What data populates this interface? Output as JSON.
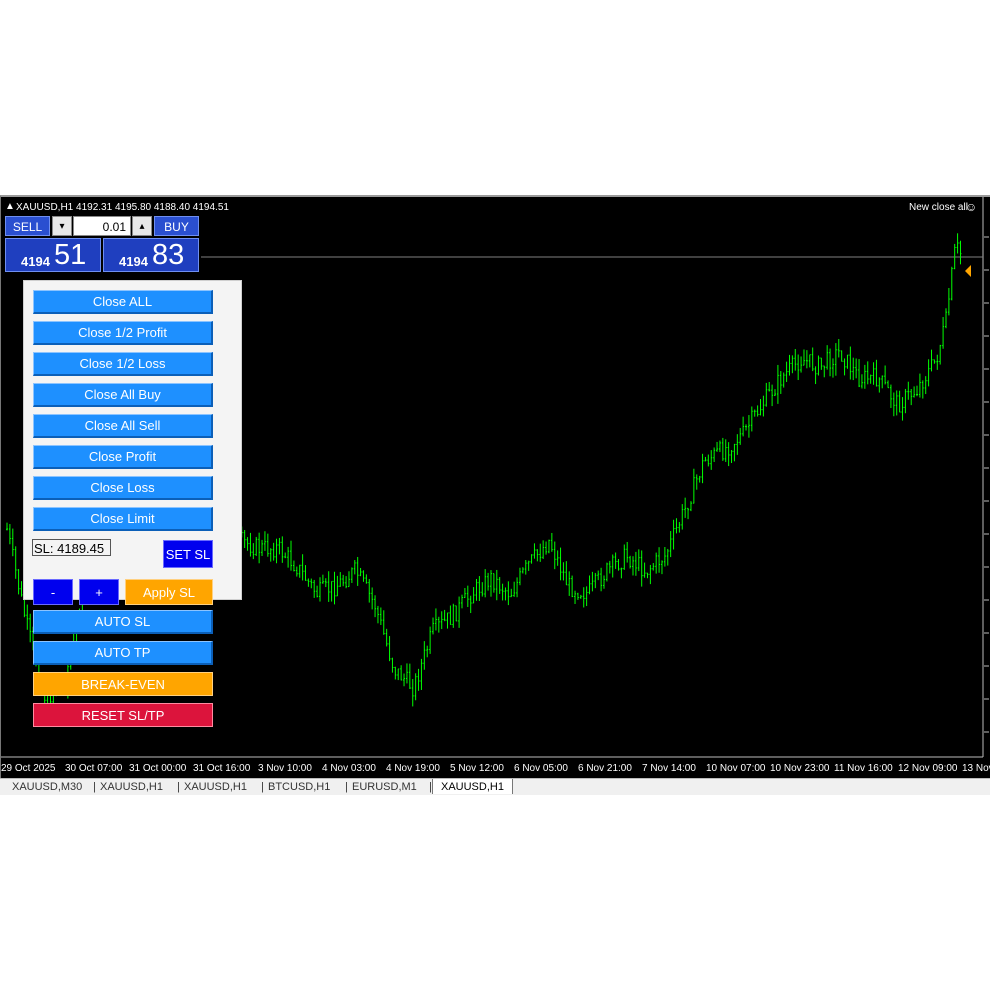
{
  "chart": {
    "symbol_info": "XAUUSD,H1  4192.31 4195.80 4188.40 4194.51",
    "ea_label": "New close all",
    "time_labels": [
      "29 Oct 2025",
      "30 Oct 07:00",
      "31 Oct 00:00",
      "31 Oct 16:00",
      "3 Nov 10:00",
      "4 Nov 03:00",
      "4 Nov 19:00",
      "5 Nov 12:00",
      "6 Nov 05:00",
      "6 Nov 21:00",
      "7 Nov 14:00",
      "10 Nov 07:00",
      "10 Nov 23:00",
      "11 Nov 16:00",
      "12 Nov 09:00",
      "13 Nov"
    ],
    "bid_line_color": "#808080",
    "candle_color": "#00ff00",
    "background": "#000000",
    "price_path": [
      [
        0,
        0.45
      ],
      [
        0.02,
        0.7
      ],
      [
        0.04,
        0.9
      ],
      [
        0.06,
        0.85
      ],
      [
        0.08,
        0.6
      ],
      [
        0.1,
        0.62
      ],
      [
        0.12,
        0.5
      ],
      [
        0.14,
        0.55
      ],
      [
        0.16,
        0.6
      ],
      [
        0.18,
        0.58
      ],
      [
        0.2,
        0.6
      ],
      [
        0.22,
        0.57
      ],
      [
        0.24,
        0.48
      ],
      [
        0.26,
        0.5
      ],
      [
        0.28,
        0.5
      ],
      [
        0.3,
        0.55
      ],
      [
        0.32,
        0.62
      ],
      [
        0.34,
        0.6
      ],
      [
        0.36,
        0.56
      ],
      [
        0.38,
        0.65
      ],
      [
        0.4,
        0.82
      ],
      [
        0.42,
        0.87
      ],
      [
        0.44,
        0.72
      ],
      [
        0.46,
        0.68
      ],
      [
        0.48,
        0.62
      ],
      [
        0.5,
        0.58
      ],
      [
        0.52,
        0.62
      ],
      [
        0.54,
        0.54
      ],
      [
        0.56,
        0.48
      ],
      [
        0.58,
        0.6
      ],
      [
        0.6,
        0.62
      ],
      [
        0.62,
        0.56
      ],
      [
        0.64,
        0.52
      ],
      [
        0.66,
        0.56
      ],
      [
        0.68,
        0.52
      ],
      [
        0.7,
        0.4
      ],
      [
        0.72,
        0.27
      ],
      [
        0.74,
        0.24
      ],
      [
        0.76,
        0.2
      ],
      [
        0.78,
        0.12
      ],
      [
        0.8,
        0.05
      ],
      [
        0.82,
        0.0
      ],
      [
        0.84,
        0.02
      ],
      [
        0.86,
        -0.02
      ],
      [
        0.88,
        0.05
      ],
      [
        0.9,
        0.05
      ],
      [
        0.92,
        0.12
      ],
      [
        0.94,
        0.08
      ],
      [
        0.96,
        0.0
      ],
      [
        0.97,
        -0.1
      ],
      [
        0.98,
        -0.3
      ],
      [
        0.985,
        -0.28
      ]
    ]
  },
  "trade_panel": {
    "sell_label": "SELL",
    "buy_label": "BUY",
    "lot_value": "0.01",
    "sell_price_small": "4194",
    "sell_price_big": "51",
    "buy_price_small": "4194",
    "buy_price_big": "83",
    "minus_arrow": "▾",
    "plus_arrow": "▴"
  },
  "close_panel": {
    "buttons": [
      "Close ALL",
      "Close 1/2 Profit",
      "Close 1/2 Loss",
      "Close All Buy",
      "Close All Sell",
      "Close Profit",
      "Close Loss",
      "Close Limit"
    ],
    "sl_value": "SL: 4189.45",
    "set_sl_label": "SET SL",
    "minus_label": "-",
    "plus_label": "+",
    "apply_sl_label": "Apply SL",
    "auto_sl_label": "AUTO SL",
    "auto_tp_label": "AUTO TP",
    "break_even_label": "BREAK-EVEN",
    "reset_label": "RESET SL/TP",
    "colors": {
      "blue": "#1e90ff",
      "dark_blue": "#0000ee",
      "orange": "#ffa500",
      "crimson": "#dc143c"
    }
  },
  "tabs": [
    "XAUUSD,M30",
    "XAUUSD,H1",
    "XAUUSD,H1",
    "BTCUSD,H1",
    "EURUSD,M1",
    "XAUUSD,H1"
  ]
}
